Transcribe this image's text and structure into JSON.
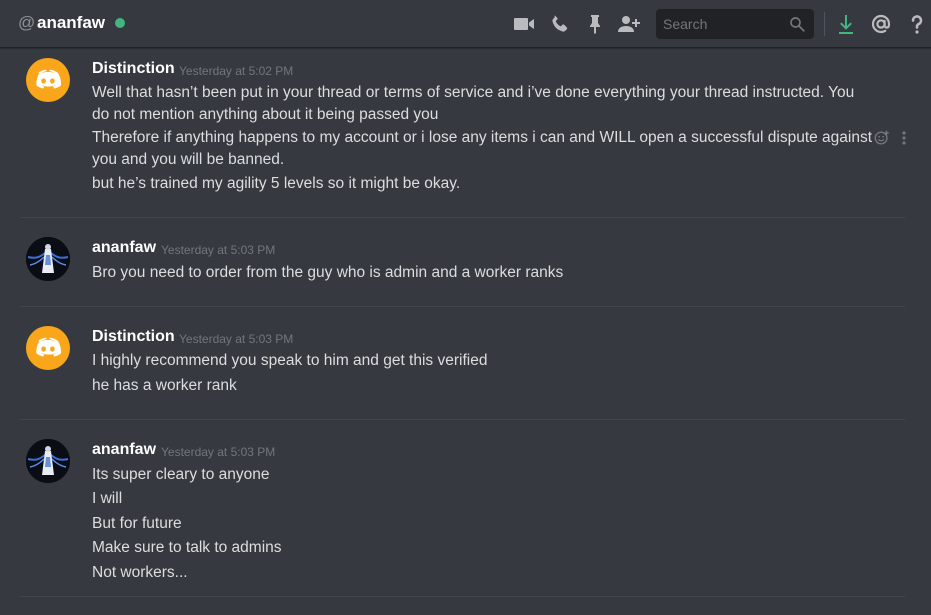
{
  "header": {
    "at_symbol": "@",
    "dm_name": "ananfaw",
    "search_placeholder": "Search",
    "icons": [
      "video-call-icon",
      "voice-call-icon",
      "pin-icon",
      "add-friend-icon",
      "search-icon",
      "download-icon",
      "mention-icon",
      "help-icon"
    ],
    "status_color": "#43b581",
    "download_color": "#43b581"
  },
  "messages": [
    {
      "author": "Distinction",
      "timestamp": "Yesterday at 5:02 PM",
      "avatar": "discord-logo-icon",
      "lines": [
        "Well that hasn’t been put in your thread or terms of service and i’ve done everything your thread instructed. You",
        "do not mention anything about it being passed you",
        "Therefore if anything happens to my account or i lose any items i can and WILL open a successful dispute against",
        "you and you will be banned.",
        "but he’s trained my agility 5 levels so it might be okay."
      ]
    },
    {
      "author": "ananfaw",
      "timestamp": "Yesterday at 5:03 PM",
      "avatar": "user-avatar",
      "lines": [
        "Bro you need to order from the guy who is admin and a worker ranks"
      ]
    },
    {
      "author": "Distinction",
      "timestamp": "Yesterday at 5:03 PM",
      "avatar": "discord-logo-icon",
      "lines": [
        "I highly recommend you speak to him and get this verified",
        "he has a worker rank"
      ]
    },
    {
      "author": "ananfaw",
      "timestamp": "Yesterday at 5:03 PM",
      "avatar": "user-avatar",
      "lines": [
        "Its super cleary to anyone",
        "I will",
        "But for future",
        "Make sure to talk to admins",
        "Not workers..."
      ]
    }
  ],
  "colors": {
    "background": "#36393f",
    "discord_avatar": "#faa61a",
    "text": "#dcddde",
    "username": "#ffffff",
    "timestamp": "#72767d"
  }
}
